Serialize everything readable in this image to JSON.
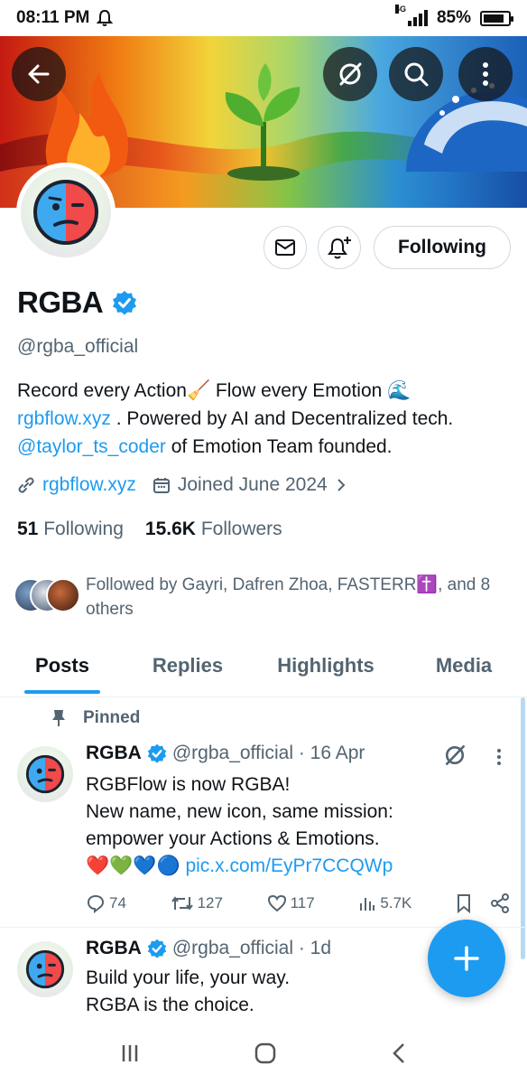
{
  "status_bar": {
    "time": "08:11 PM",
    "network": "4G",
    "battery": "85%",
    "battery_level": 0.85
  },
  "banner": {
    "buttons": [
      "back-arrow",
      "grok-icon",
      "search-icon",
      "more-vertical-icon"
    ]
  },
  "profile": {
    "display_name": "RGBA",
    "handle": "@rgba_official",
    "following_button": "Following",
    "bio": {
      "line1_a": "Record every Action",
      "line1_b": " Flow every Emotion",
      "line1_emoji_1": "🧹",
      "line1_emoji_2": "🌊",
      "line2_link": "rgbflow.xyz",
      "line2_text": " . Powered by AI and Decentralized tech.",
      "line3_mention": "@taylor_ts_coder",
      "line3_text": " of Emotion Team founded."
    },
    "website": "rgbflow.xyz",
    "joined": "Joined June 2024",
    "following_count": "51",
    "following_label": "Following",
    "followers_count": "15.6K",
    "followers_label": "Followers",
    "followed_by_text": "Followed by Gayri, Dafren Zhoa, FASTERR✝️, and 8 others"
  },
  "tabs": [
    {
      "label": "Posts",
      "active": true
    },
    {
      "label": "Replies",
      "active": false
    },
    {
      "label": "Highlights",
      "active": false
    },
    {
      "label": "Media",
      "active": false
    }
  ],
  "posts": [
    {
      "pinned_label": "Pinned",
      "name": "RGBA",
      "handle_time": "@rgba_official · 16 Apr",
      "line1": "RGBFlow is now RGBA!",
      "line2": "New name, new icon, same mission:",
      "line3": "empower your Actions & Emotions.",
      "line4_emoji": "❤️💚💙🔵",
      "line4_link": "pic.x.com/EyPr7CCQWp",
      "replies": "74",
      "reposts": "127",
      "likes": "117",
      "views": "5.7K"
    },
    {
      "name": "RGBA",
      "handle_time": "@rgba_official · 1d",
      "line1": "Build your life, your way.",
      "line2": "RGBA is the choice."
    }
  ],
  "colors": {
    "accent": "#1d9bf0",
    "text": "#0f1419",
    "muted": "#536471",
    "border": "#cfd9de"
  }
}
